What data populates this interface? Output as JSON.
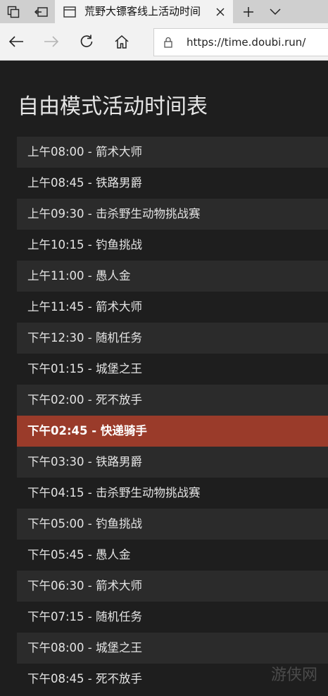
{
  "browser": {
    "tab_title": "荒野大镖客线上活动时间",
    "url": "https://time.doubi.run/"
  },
  "page": {
    "title": "自由模式活动时间表",
    "schedule": [
      "上午08:00 - 箭术大师",
      "上午08:45 - 铁路男爵",
      "上午09:30 - 击杀野生动物挑战赛",
      "上午10:15 - 钓鱼挑战",
      "上午11:00 - 愚人金",
      "上午11:45 - 箭术大师",
      "下午12:30 - 随机任务",
      "下午01:15 - 城堡之王",
      "下午02:00 - 死不放手",
      "下午02:45 - 快递骑手",
      "下午03:30 - 铁路男爵",
      "下午04:15 - 击杀野生动物挑战赛",
      "下午05:00 - 钓鱼挑战",
      "下午05:45 - 愚人金",
      "下午06:30 - 箭术大师",
      "下午07:15 - 随机任务",
      "下午08:00 - 城堡之王",
      "下午08:45 - 死不放手"
    ],
    "active_index": 9,
    "active_color": "#9a3b2a"
  },
  "watermark": "游侠网"
}
